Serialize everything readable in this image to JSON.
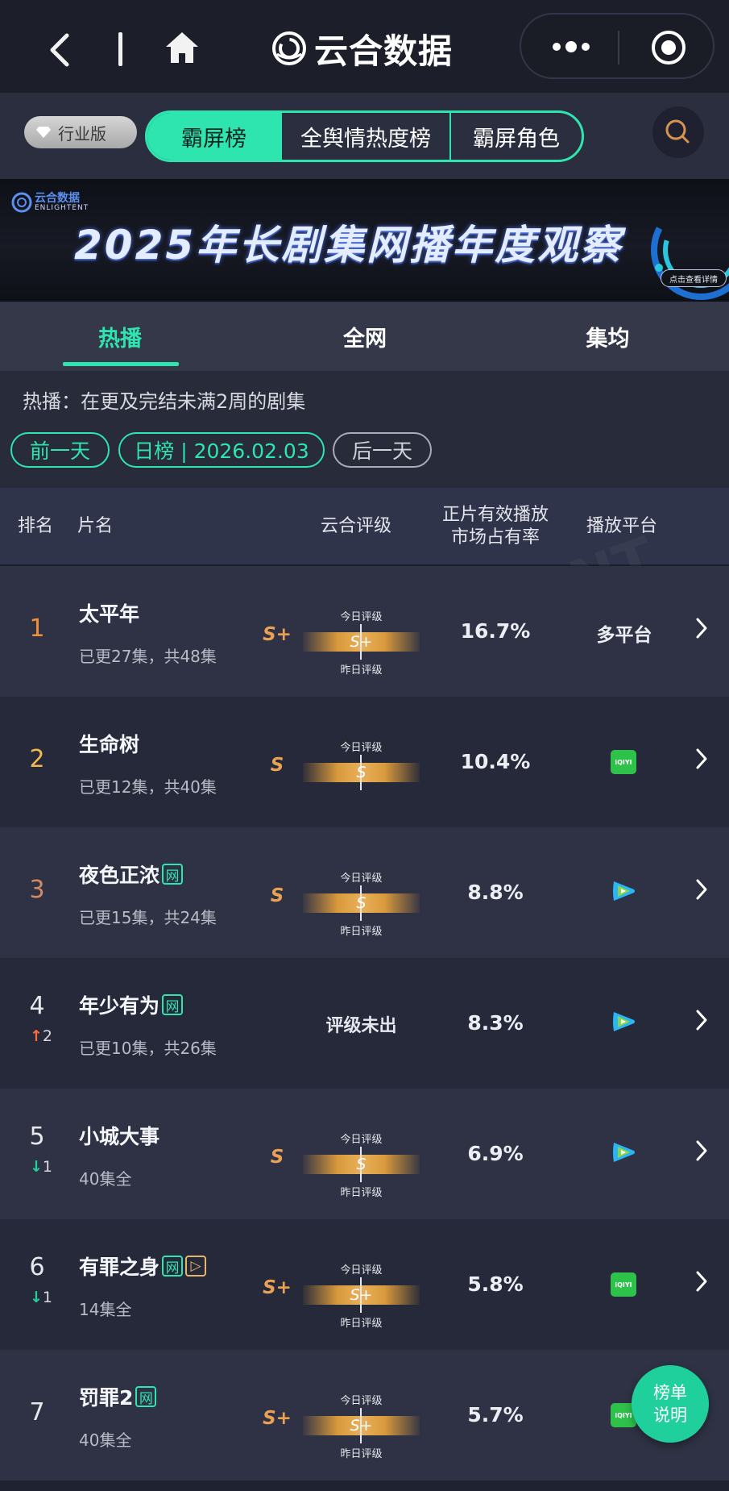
{
  "nav": {
    "title": "云合数据",
    "icons": {
      "back": "chevron-left-icon",
      "home": "home-icon",
      "more": "more-dots-icon",
      "close": "target-icon"
    }
  },
  "category": {
    "industry_label": "行业版",
    "segments": [
      "霸屏榜",
      "全舆情热度榜",
      "霸屏角色"
    ],
    "active_segment": "霸屏榜",
    "accent_color": "#2ee5b0"
  },
  "banner": {
    "logo_text": "云合数据",
    "logo_sub": "ENLIGHTENT",
    "title": "2025年长剧集网播年度观察",
    "cta": "点击查看详情"
  },
  "tabs": [
    "热播",
    "全网",
    "集均"
  ],
  "active_tab": "热播",
  "filter": {
    "description": "热播：在更及完结未满2周的剧集",
    "prev_label": "前一天",
    "date_label": "日榜 | 2026.02.03",
    "next_label": "后一天"
  },
  "table_header": {
    "rank": "排名",
    "name": "片名",
    "rating": "云合评级",
    "share_line1": "正片有效播放",
    "share_line2": "市场占有率",
    "platform": "播放平台"
  },
  "rating_labels": {
    "today": "今日评级",
    "yesterday": "昨日评级"
  },
  "rows": [
    {
      "rank": "1",
      "change": "",
      "change_dir": "",
      "name": "太平年",
      "tags": [],
      "episodes": "已更27集，共48集",
      "grade_left": "S+",
      "rating": "S+",
      "share": "16.7%",
      "platform": "多平台",
      "platform_icon": ""
    },
    {
      "rank": "2",
      "change": "",
      "change_dir": "",
      "name": "生命树",
      "tags": [],
      "episodes": "已更12集，共40集",
      "grade_left": "S",
      "rating": "S",
      "share": "10.4%",
      "platform": "",
      "platform_icon": "iqiyi-icon"
    },
    {
      "rank": "3",
      "change": "",
      "change_dir": "",
      "name": "夜色正浓",
      "tags": [
        "网"
      ],
      "episodes": "已更15集，共24集",
      "grade_left": "S",
      "rating": "S",
      "share": "8.8%",
      "platform": "",
      "platform_icon": "tencent-video-icon"
    },
    {
      "rank": "4",
      "change": "2",
      "change_dir": "up",
      "name": "年少有为",
      "tags": [
        "网"
      ],
      "episodes": "已更10集，共26集",
      "grade_left": "",
      "rating": "评级未出",
      "share": "8.3%",
      "platform": "",
      "platform_icon": "tencent-video-icon"
    },
    {
      "rank": "5",
      "change": "1",
      "change_dir": "down",
      "name": "小城大事",
      "tags": [],
      "episodes": "40集全",
      "grade_left": "S",
      "rating": "S",
      "share": "6.9%",
      "platform": "",
      "platform_icon": "tencent-video-icon"
    },
    {
      "rank": "6",
      "change": "1",
      "change_dir": "down",
      "name": "有罪之身",
      "tags": [
        "网",
        "▷"
      ],
      "episodes": "14集全",
      "grade_left": "S+",
      "rating": "S+",
      "share": "5.8%",
      "platform": "",
      "platform_icon": "iqiyi-icon"
    },
    {
      "rank": "7",
      "change": "",
      "change_dir": "",
      "name": "罚罪2",
      "tags": [
        "网"
      ],
      "episodes": "40集全",
      "grade_left": "S+",
      "rating": "S+",
      "share": "5.7%",
      "platform": "",
      "platform_icon": "iqiyi-icon"
    }
  ],
  "iqiyi_text": "iQIYI",
  "float_button": {
    "line1": "榜单",
    "line2": "说明"
  }
}
